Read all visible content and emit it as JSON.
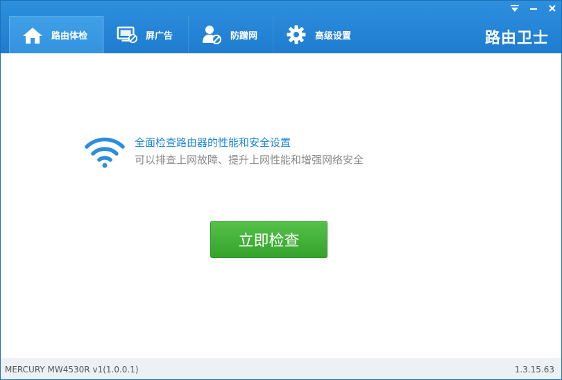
{
  "header": {
    "tabs": [
      {
        "label": "路由体检",
        "icon": "home-icon",
        "active": true
      },
      {
        "label": "屏广告",
        "icon": "screen-block-icon",
        "active": false
      },
      {
        "label": "防蹭网",
        "icon": "user-block-icon",
        "active": false
      },
      {
        "label": "高级设置",
        "icon": "gear-icon",
        "active": false
      }
    ],
    "brand": "路由卫士"
  },
  "window_controls": [
    "menu-dropdown-icon",
    "minimize-icon",
    "close-icon"
  ],
  "main": {
    "icon": "wifi-icon",
    "line1": "全面检查路由器的性能和安全设置",
    "line2": "可以排查上网故障、提升上网性能和增强网络安全",
    "check_button": "立即检查"
  },
  "footer": {
    "device": "MERCURY MW4530R v1(1.0.0.1)",
    "version": "1.3.15.63"
  },
  "colors": {
    "header": "#2585d6",
    "accent_text": "#1f86d1",
    "button": "#45b23a"
  }
}
